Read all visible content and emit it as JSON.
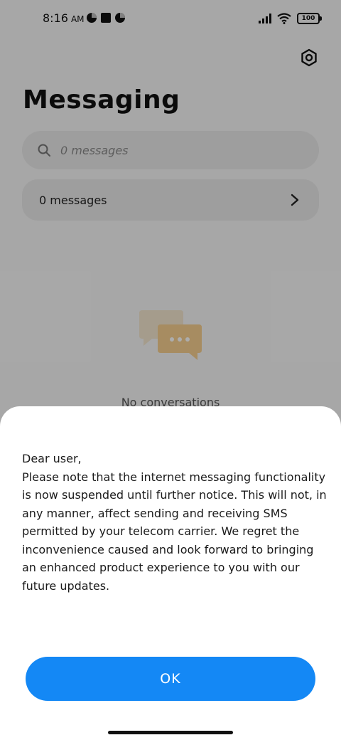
{
  "status_bar": {
    "time": "8:16",
    "ampm": "AM",
    "battery": "100",
    "icons": [
      "pie-icon",
      "square-icon",
      "pie-icon",
      "signal-icon",
      "wifi-icon",
      "battery-icon"
    ]
  },
  "header": {
    "title": "Messaging",
    "settings_icon": "gear-icon"
  },
  "search": {
    "placeholder": "0 messages",
    "value": "",
    "icon": "search-icon"
  },
  "messages_row": {
    "label": "0 messages",
    "icon": "chevron-right-icon"
  },
  "empty_state": {
    "icon": "chat-bubbles-icon",
    "text": "No conversations"
  },
  "dialog": {
    "message": "Dear user,\nPlease note that the internet messaging functionality is now suspended until further notice. This will not, in any manner, affect sending and receiving SMS permitted by your telecom carrier. We regret the inconvenience caused and look forward to bringing an enhanced product experience to you with our future updates.",
    "ok_label": "OK",
    "accent": "#1488f5"
  }
}
